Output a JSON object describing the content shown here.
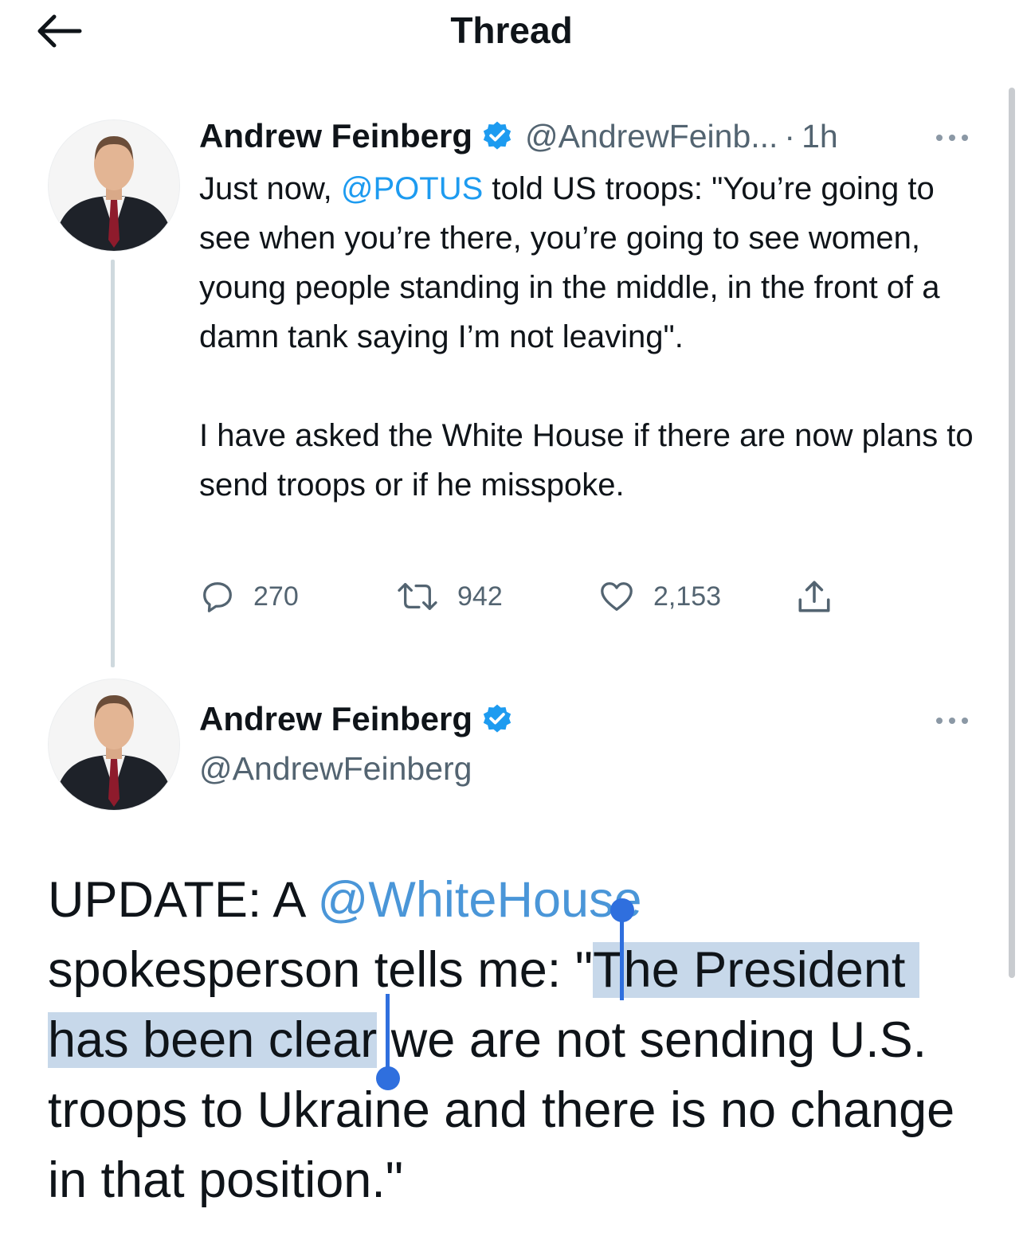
{
  "header": {
    "title": "Thread",
    "back_icon": "arrow-left-icon"
  },
  "tweet1": {
    "name": "Andrew Feinberg",
    "handle": "@AndrewFeinb...",
    "sep": "·",
    "time": "1h",
    "text_1": "Just now, ",
    "mention": "@POTUS",
    "text_2": " told US troops: \"You’re going to see when you’re there, you’re going to see women, young people standing in the middle, in the front of a damn tank saying I’m not leaving\".\n\nI have asked the White House if there are now plans to send troops or if he misspoke.",
    "replies": "270",
    "retweets": "942",
    "likes": "2,153"
  },
  "tweet2": {
    "name": "Andrew Feinberg",
    "handle": "@AndrewFeinberg",
    "text_1": "UPDATE: A ",
    "mention": "@WhiteHouse",
    "text_2": "\nspokesperson tells me: \"",
    "selected": "The President has been clear",
    "text_3": " we are not sending U.S. troops to Ukraine and there is no change in that position.\""
  },
  "colors": {
    "accent": "#1d9bf0",
    "selection": "#c7d8ea",
    "handle": "#3a7bd5",
    "verified": "#1d9bf0"
  }
}
